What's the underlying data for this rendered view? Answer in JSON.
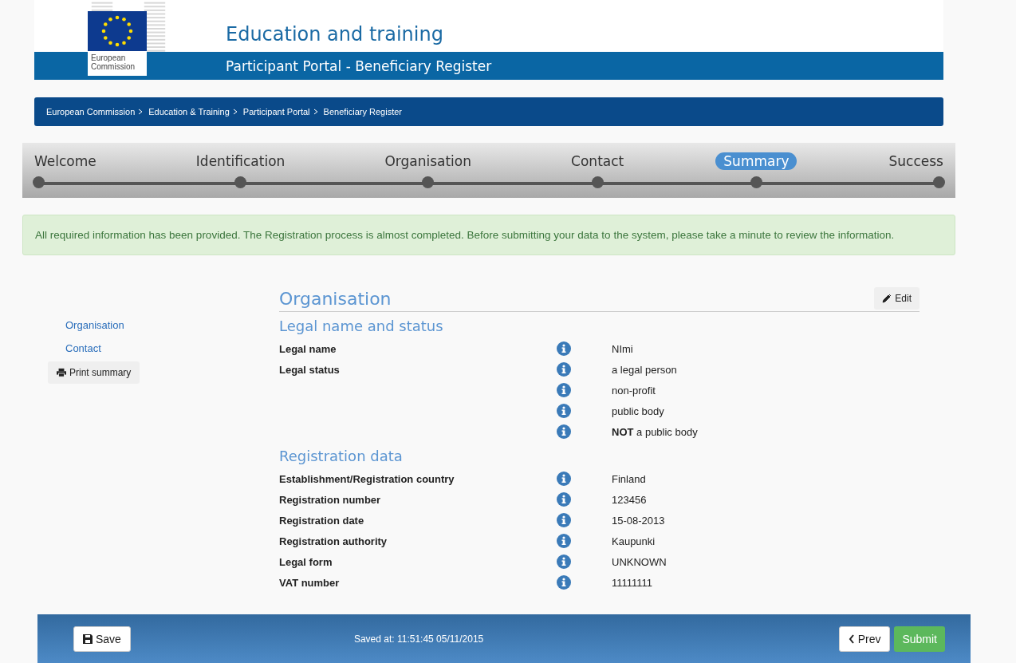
{
  "header": {
    "logo_text": "European Commission",
    "title": "Education and training",
    "subtitle": "Participant Portal - Beneficiary Register"
  },
  "breadcrumb": [
    "European Commission",
    "Education & Training",
    "Participant Portal",
    "Beneficiary Register"
  ],
  "steps": [
    {
      "label": "Welcome",
      "selected": false
    },
    {
      "label": "Identification",
      "selected": false
    },
    {
      "label": "Organisation",
      "selected": false
    },
    {
      "label": "Contact",
      "selected": false
    },
    {
      "label": "Summary",
      "selected": true
    },
    {
      "label": "Success",
      "selected": false
    }
  ],
  "alert": "All required information has been provided. The Registration process is almost completed. Before submitting your data to the system, please take a minute to review the information.",
  "sidebar": {
    "links": [
      "Organisation",
      "Contact"
    ],
    "print_button": "Print summary"
  },
  "panel": {
    "title": "Organisation",
    "edit_button": "Edit",
    "sections": [
      {
        "title": "Legal name and status",
        "rows": [
          {
            "label": "Legal name",
            "value": "NImi"
          },
          {
            "label": "Legal status",
            "value": "a legal person"
          },
          {
            "label": "",
            "value": "non-profit"
          },
          {
            "label": "",
            "value": "public body"
          },
          {
            "label": "",
            "value": "**NOT** a public body"
          }
        ]
      },
      {
        "title": "Registration data",
        "rows": [
          {
            "label": "Establishment/Registration country",
            "value": "Finland"
          },
          {
            "label": "Registration number",
            "value": "123456"
          },
          {
            "label": "Registration date",
            "value": "15-08-2013"
          },
          {
            "label": "Registration authority",
            "value": "Kaupunki"
          },
          {
            "label": "Legal form",
            "value": "UNKNOWN"
          },
          {
            "label": "VAT number",
            "value": "11111111"
          }
        ]
      }
    ]
  },
  "footer": {
    "save_button": "Save",
    "saved_at": "Saved at: 11:51:45 05/11/2015",
    "prev_button": "Prev",
    "submit_button": "Submit"
  }
}
